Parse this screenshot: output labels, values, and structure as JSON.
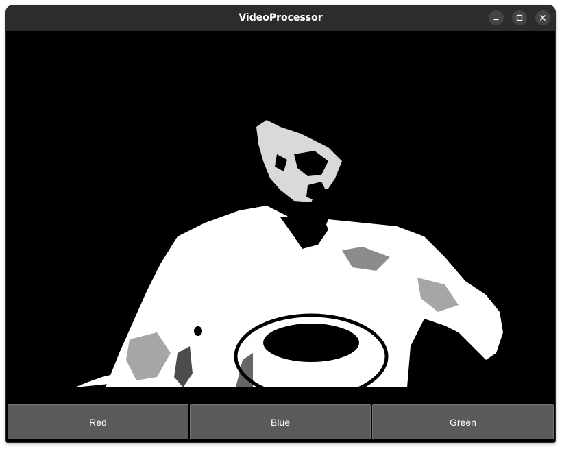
{
  "window": {
    "title": "VideoProcessor"
  },
  "titlebar_buttons": [
    {
      "icon": "minimize-icon"
    },
    {
      "icon": "maximize-icon"
    },
    {
      "icon": "close-icon"
    }
  ],
  "video": {
    "description_icon": "video-frame"
  },
  "buttons": {
    "red_label": "Red",
    "blue_label": "Blue",
    "green_label": "Green"
  },
  "colors": {
    "titlebar": "#2c2c2c",
    "button_bg": "#5a5a5a",
    "video_bg": "#000000"
  }
}
